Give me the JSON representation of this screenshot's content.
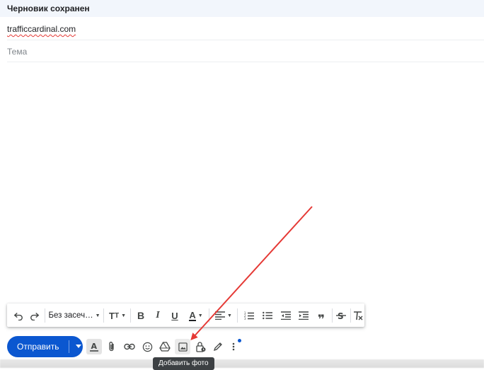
{
  "header": {
    "title": "Черновик сохранен"
  },
  "compose": {
    "recipient": "trafficcardinal.com",
    "subject_placeholder": "Тема",
    "subject_value": ""
  },
  "format_toolbar": {
    "font_name": "Без засеч…",
    "icons": [
      "undo-icon",
      "redo-icon",
      "font-size-icon",
      "bold-icon",
      "italic-icon",
      "underline-icon",
      "text-color-icon",
      "align-icon",
      "numbered-list-icon",
      "bulleted-list-icon",
      "indent-less-icon",
      "indent-more-icon",
      "quote-icon",
      "strikethrough-icon",
      "remove-formatting-icon"
    ]
  },
  "bottom_toolbar": {
    "send_label": "Отправить",
    "icons": [
      "formatting-options-icon",
      "attach-icon",
      "link-icon",
      "emoji-icon",
      "drive-icon",
      "insert-photo-icon",
      "confidential-mode-icon",
      "signature-icon",
      "more-options-icon"
    ]
  },
  "tooltip": {
    "text": "Добавить фото"
  },
  "colors": {
    "send": "#0b57d0",
    "arrow": "#e53935",
    "header_bg": "#f2f6fc"
  }
}
